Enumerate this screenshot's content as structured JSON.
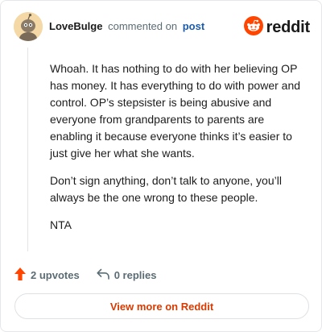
{
  "header": {
    "username": "LoveBulge",
    "commented_on": "commented on",
    "post_link": "post",
    "brand": "reddit"
  },
  "comment": {
    "paragraphs": [
      "Whoah. It has nothing to do with her believing OP has money. It has everything to do with power and control. OP’s stepsister is being abusive and everyone from grandparents to parents are enabling it because everyone thinks it’s easier to just give her what she wants.",
      "Don’t sign anything, don’t talk to anyone, you’ll always be the one wrong to these people.",
      "NTA"
    ]
  },
  "actions": {
    "upvotes": "2 upvotes",
    "replies": "0 replies"
  },
  "footer": {
    "view_more": "View more on Reddit"
  },
  "colors": {
    "brand_orange": "#ff4500",
    "link_blue": "#1d5bab",
    "view_more_text": "#d93a00"
  },
  "icons": [
    "user-avatar-icon",
    "reddit-logo-icon",
    "upvote-arrow-icon",
    "reply-arrow-icon"
  ]
}
